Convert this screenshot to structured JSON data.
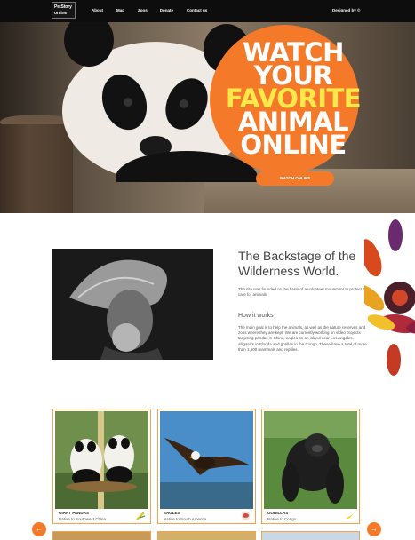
{
  "nav": {
    "logo_line1": "PetStory",
    "logo_line2": "online",
    "links": [
      "About",
      "Map",
      "Zoos",
      "Donate",
      "Contact us"
    ],
    "designed_by": "Designed by ©"
  },
  "hero": {
    "title_lines": [
      "WATCH",
      "YOUR",
      "FAVORITE",
      "ANIMAL",
      "ONLINE"
    ],
    "highlight_line": "FAVORITE",
    "button_label": "WATCH ONLINE",
    "accent_color": "#f47a2a",
    "highlight_color": "#ffe94a"
  },
  "about": {
    "title": "The Backstage of the Wilderness World.",
    "text": "The site was founded on the basis of a volunteer movement to protect and care for animals.",
    "how_title": "How it works",
    "how_text": "The main goal is to help the animals, as well as the nature reserves and zoos where they are kept. We are currently working on video projects targeting pandas in China, eagles on an island near Los Angeles, alligators in Florida and gorillas in the Congo. These have a total of more than 1,500 mammals and reptiles."
  },
  "cards": [
    {
      "name": "GIANT PANDAS",
      "habitat": "Native to Southwest China",
      "badge_icon": "bamboo-icon"
    },
    {
      "name": "EAGLES",
      "habitat": "Native to South America",
      "badge_icon": "meat-icon"
    },
    {
      "name": "GORILLAS",
      "habitat": "Native to Congo",
      "badge_icon": "banana-icon"
    }
  ],
  "carousel": {
    "prev_icon": "←",
    "next_icon": "→"
  }
}
